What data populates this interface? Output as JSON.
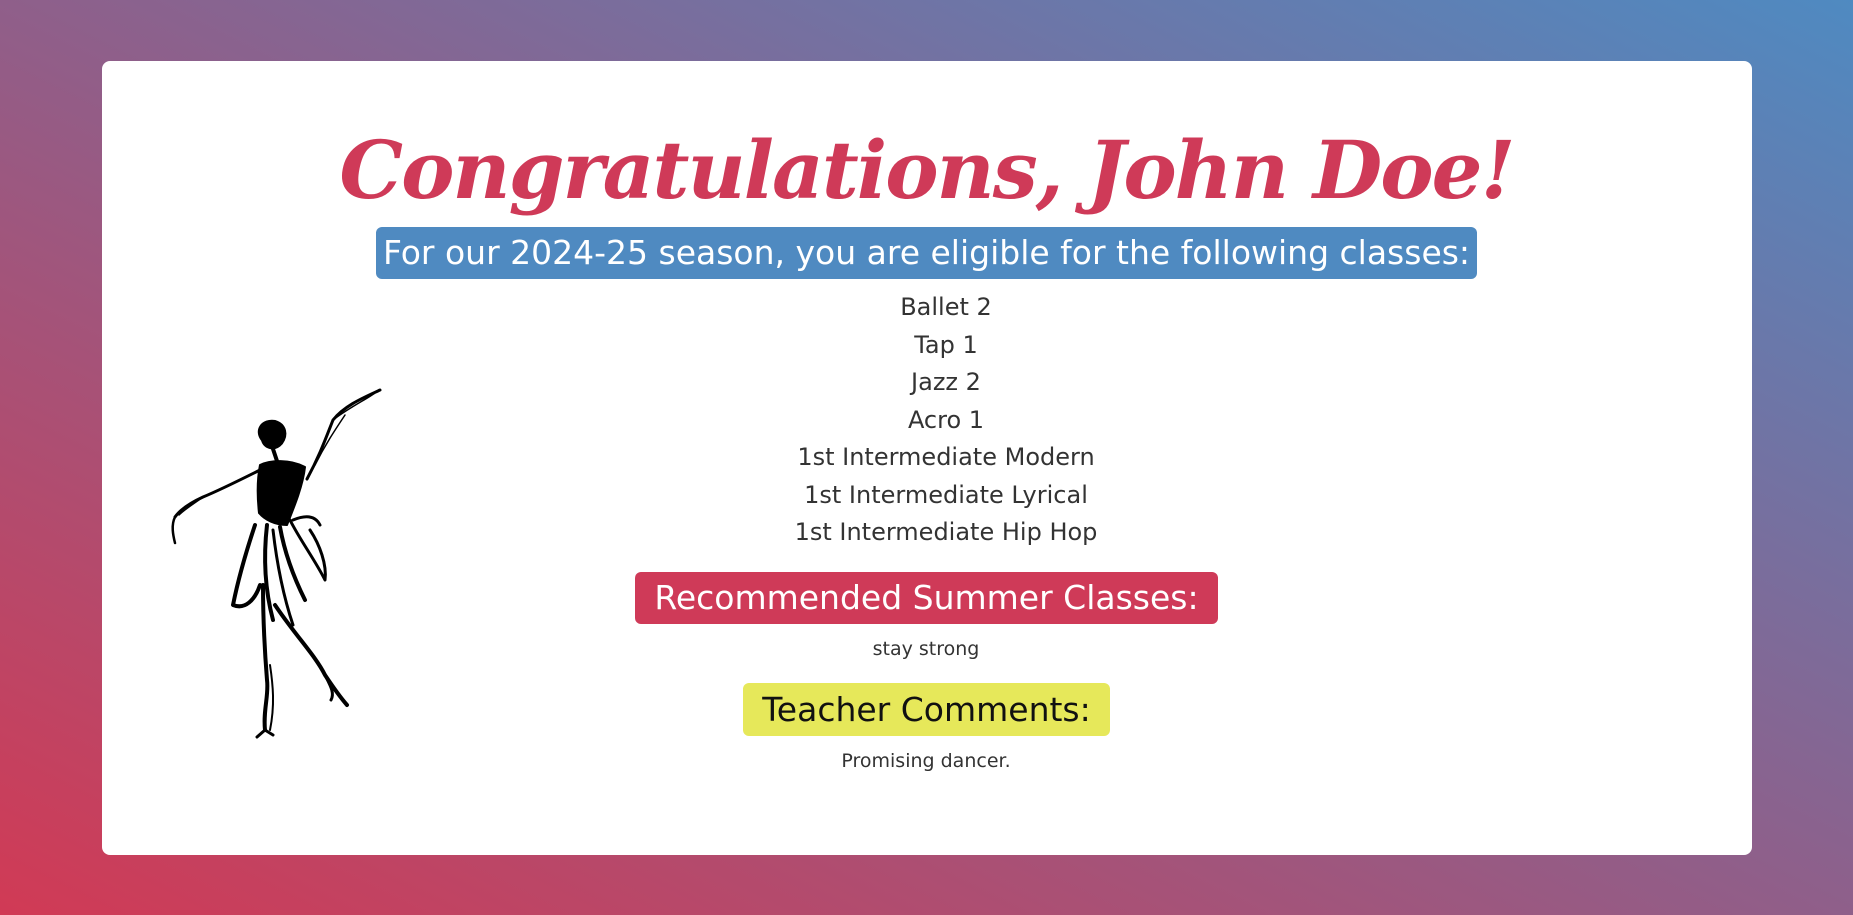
{
  "title": "Congratulations, John Doe!",
  "season_banner": "For our 2024-25 season, you are eligible for the following classes:",
  "classes": [
    "Ballet 2",
    "Tap 1",
    "Jazz 2",
    "Acro 1",
    "1st Intermediate Modern",
    "1st Intermediate Lyrical",
    "1st Intermediate Hip Hop"
  ],
  "summer": {
    "heading": "Recommended Summer Classes:",
    "text": "stay strong"
  },
  "teacher": {
    "heading": "Teacher Comments:",
    "text": "Promising dancer."
  },
  "illustration": "dancer-sketch-icon",
  "colors": {
    "title": "#cf3a58",
    "banner_blue": "#4f8ac1",
    "badge_red": "#cf3a58",
    "badge_yellow": "#e6e85a",
    "gradient_start": "#d13a55",
    "gradient_end": "#4f8ac1"
  }
}
